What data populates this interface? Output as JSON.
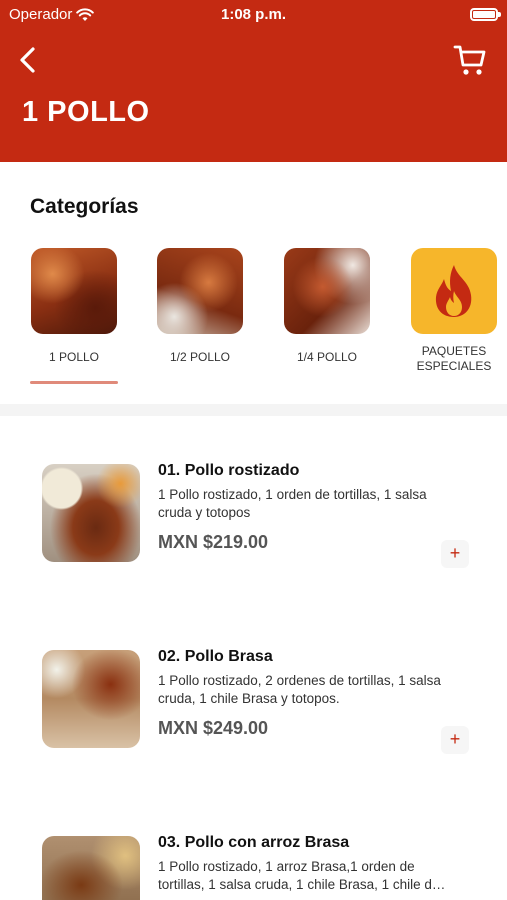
{
  "status_bar": {
    "carrier": "Operador",
    "time": "1:08 p.m."
  },
  "header": {
    "title": "1 POLLO",
    "back_icon": "chevron-left-icon",
    "cart_icon": "cart-icon"
  },
  "categories": {
    "heading": "Categorías",
    "items": [
      {
        "label": "1 POLLO",
        "selected": true
      },
      {
        "label": "1/2 POLLO"
      },
      {
        "label": "1/4 POLLO"
      },
      {
        "label_line1": "PAQUETES",
        "label_line2": "ESPECIALES",
        "icon": "fire-icon"
      }
    ]
  },
  "products": [
    {
      "name": "01. Pollo rostizado",
      "desc_line1": "1 Pollo rostizado, 1 orden de tortillas, 1 salsa",
      "desc_line2": "cruda y totopos",
      "price": "MXN $219.00",
      "add": "+"
    },
    {
      "name": "02. Pollo Brasa",
      "desc_line1": "1 Pollo rostizado, 2 ordenes de tortillas, 1 salsa",
      "desc_line2": "cruda, 1 chile Brasa y totopos.",
      "price": "MXN $249.00",
      "add": "+"
    },
    {
      "name": "03. Pollo con arroz Brasa",
      "desc_line1": "1 Pollo rostizado, 1 arroz Brasa,1 orden de",
      "desc_line2": "tortillas, 1 salsa cruda, 1 chile Brasa, 1 chile d…"
    }
  ],
  "colors": {
    "brand": "#c42a12",
    "accent_tile": "#f6b62b",
    "underline": "#e08a7a"
  }
}
